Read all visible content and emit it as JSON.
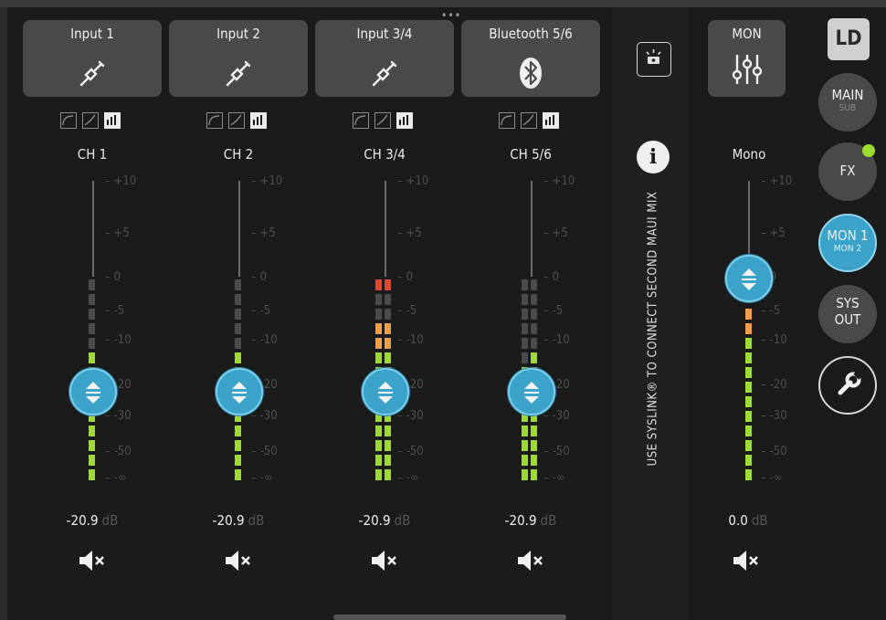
{
  "channels": [
    {
      "source_label": "Input 1",
      "source_icon": "jack-cable-icon",
      "name": "CH 1",
      "level_db": "-20.9",
      "unit": "dB"
    },
    {
      "source_label": "Input 2",
      "source_icon": "jack-cable-icon",
      "name": "CH 2",
      "level_db": "-20.9",
      "unit": "dB"
    },
    {
      "source_label": "Input 3/4",
      "source_icon": "jack-cable-icon",
      "name": "CH 3/4",
      "level_db": "-20.9",
      "unit": "dB"
    },
    {
      "source_label": "Bluetooth 5/6",
      "source_icon": "bluetooth-icon",
      "name": "CH 5/6",
      "level_db": "-20.9",
      "unit": "dB"
    }
  ],
  "scale_labels": [
    "+10",
    "+5",
    "0",
    "-5",
    "-10",
    "-20",
    "-30",
    "-50",
    "-∞"
  ],
  "syslink_text": "USE SYSLINK® TO CONNECT SECOND MAUI MIX",
  "monitor": {
    "source_label": "MON",
    "name": "Mono",
    "level_db": "0.0",
    "unit": "dB"
  },
  "side_buttons": {
    "main": {
      "l1": "MAIN",
      "l2": "SUB"
    },
    "fx": {
      "l1": "FX"
    },
    "mon": {
      "l1": "MON 1",
      "l2": "MON 2"
    },
    "sys": {
      "l1": "SYS",
      "l2": "OUT"
    }
  },
  "logo_text": "LD",
  "colors": {
    "accent": "#3ba2c9",
    "meter_green": "#9bdc2c",
    "meter_orange": "#f0a040",
    "meter_red": "#e8422a",
    "fx_dot": "#9bdc2c"
  }
}
